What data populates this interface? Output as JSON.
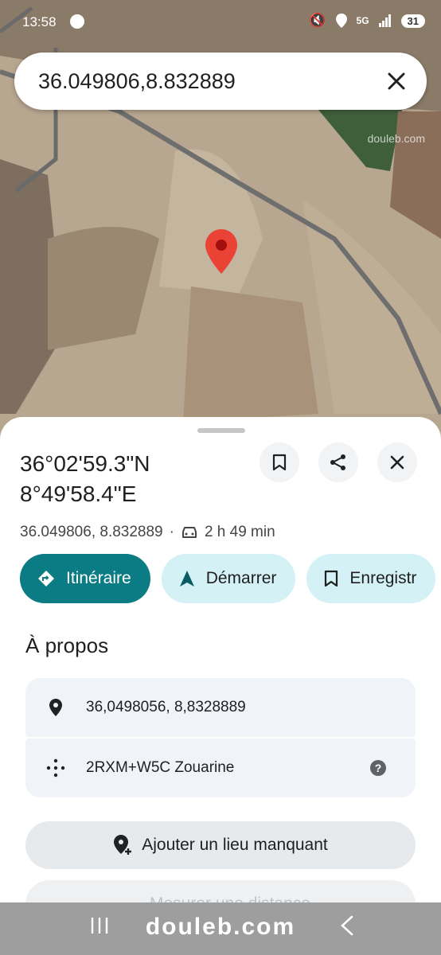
{
  "status_bar": {
    "time": "13:58",
    "network": "5G",
    "battery": "31"
  },
  "search": {
    "query": "36.049806,8.832889"
  },
  "map": {
    "watermark": "douleb.com"
  },
  "place": {
    "title_line1": "36°02'59.3\"N",
    "title_line2": "8°49'58.4\"E",
    "coords": "36.049806, 8.832889",
    "separator": "·",
    "travel_time": "2 h 49 min"
  },
  "actions": {
    "directions": "Itinéraire",
    "start": "Démarrer",
    "save": "Enregistr"
  },
  "about": {
    "title": "À propos",
    "coordinates": "36,0498056, 8,8328889",
    "plus_code": "2RXM+W5C Zouarine"
  },
  "add_place": "Ajouter un lieu manquant",
  "measure_distance": "Mesurer une distance",
  "nav": {
    "watermark": "douleb.com"
  },
  "colors": {
    "primary": "#0b7b84",
    "tonal": "#d4f1f6",
    "pin": "#ea4335"
  }
}
